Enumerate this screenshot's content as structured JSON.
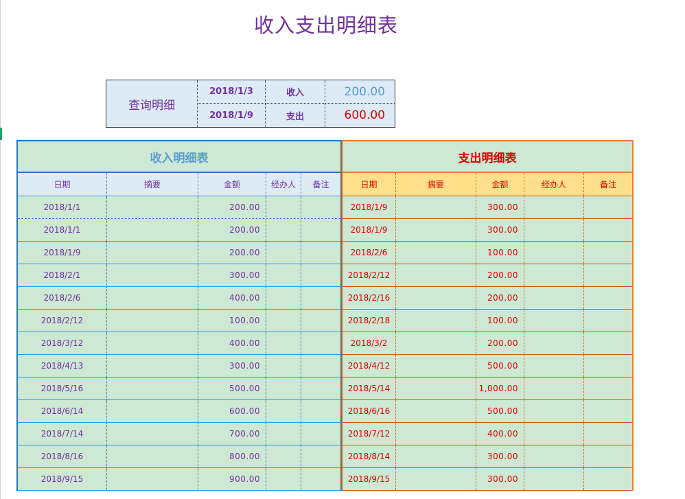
{
  "title": "收入支出明细表",
  "query": {
    "label": "查询明细",
    "start_date": "2018/1/3",
    "end_date": "2018/1/9",
    "income_label": "收入",
    "expense_label": "支出",
    "income_value": "200.00",
    "expense_value": "600.00"
  },
  "income": {
    "title": "收入明细表",
    "columns": [
      "日期",
      "摘要",
      "金额",
      "经办人",
      "备注"
    ],
    "rows": [
      {
        "date": "2018/1/1",
        "summary": "",
        "amount": "200.00",
        "handler": "",
        "note": ""
      },
      {
        "date": "2018/1/1",
        "summary": "",
        "amount": "200.00",
        "handler": "",
        "note": ""
      },
      {
        "date": "2018/1/9",
        "summary": "",
        "amount": "200.00",
        "handler": "",
        "note": ""
      },
      {
        "date": "2018/2/1",
        "summary": "",
        "amount": "300.00",
        "handler": "",
        "note": ""
      },
      {
        "date": "2018/2/6",
        "summary": "",
        "amount": "400.00",
        "handler": "",
        "note": ""
      },
      {
        "date": "2018/2/12",
        "summary": "",
        "amount": "100.00",
        "handler": "",
        "note": ""
      },
      {
        "date": "2018/3/12",
        "summary": "",
        "amount": "400.00",
        "handler": "",
        "note": ""
      },
      {
        "date": "2018/4/13",
        "summary": "",
        "amount": "300.00",
        "handler": "",
        "note": ""
      },
      {
        "date": "2018/5/16",
        "summary": "",
        "amount": "500.00",
        "handler": "",
        "note": ""
      },
      {
        "date": "2018/6/14",
        "summary": "",
        "amount": "600.00",
        "handler": "",
        "note": ""
      },
      {
        "date": "2018/7/14",
        "summary": "",
        "amount": "700.00",
        "handler": "",
        "note": ""
      },
      {
        "date": "2018/8/16",
        "summary": "",
        "amount": "800.00",
        "handler": "",
        "note": ""
      },
      {
        "date": "2018/9/15",
        "summary": "",
        "amount": "900.00",
        "handler": "",
        "note": ""
      }
    ]
  },
  "expense": {
    "title": "支出明细表",
    "columns": [
      "日期",
      "摘要",
      "金额",
      "经办人",
      "备注"
    ],
    "rows": [
      {
        "date": "2018/1/9",
        "summary": "",
        "amount": "300.00",
        "handler": "",
        "note": ""
      },
      {
        "date": "2018/1/9",
        "summary": "",
        "amount": "300.00",
        "handler": "",
        "note": ""
      },
      {
        "date": "2018/2/6",
        "summary": "",
        "amount": "100.00",
        "handler": "",
        "note": ""
      },
      {
        "date": "2018/2/12",
        "summary": "",
        "amount": "200.00",
        "handler": "",
        "note": ""
      },
      {
        "date": "2018/2/16",
        "summary": "",
        "amount": "200.00",
        "handler": "",
        "note": ""
      },
      {
        "date": "2018/2/18",
        "summary": "",
        "amount": "100.00",
        "handler": "",
        "note": ""
      },
      {
        "date": "2018/3/2",
        "summary": "",
        "amount": "200.00",
        "handler": "",
        "note": ""
      },
      {
        "date": "2018/4/12",
        "summary": "",
        "amount": "500.00",
        "handler": "",
        "note": ""
      },
      {
        "date": "2018/5/14",
        "summary": "",
        "amount": "1,000.00",
        "handler": "",
        "note": ""
      },
      {
        "date": "2018/6/16",
        "summary": "",
        "amount": "500.00",
        "handler": "",
        "note": ""
      },
      {
        "date": "2018/7/12",
        "summary": "",
        "amount": "400.00",
        "handler": "",
        "note": ""
      },
      {
        "date": "2018/8/14",
        "summary": "",
        "amount": "300.00",
        "handler": "",
        "note": ""
      },
      {
        "date": "2018/9/15",
        "summary": "",
        "amount": "300.00",
        "handler": "",
        "note": ""
      }
    ]
  },
  "colors": {
    "title": "#7030a0",
    "income_accent": "#2e75b6",
    "expense_accent": "#ed7d31",
    "expense_text": "#e00000",
    "cell_bg": "#cde8d3",
    "income_header_bg": "#ddebf7",
    "expense_header_bg": "#ffe08a"
  }
}
